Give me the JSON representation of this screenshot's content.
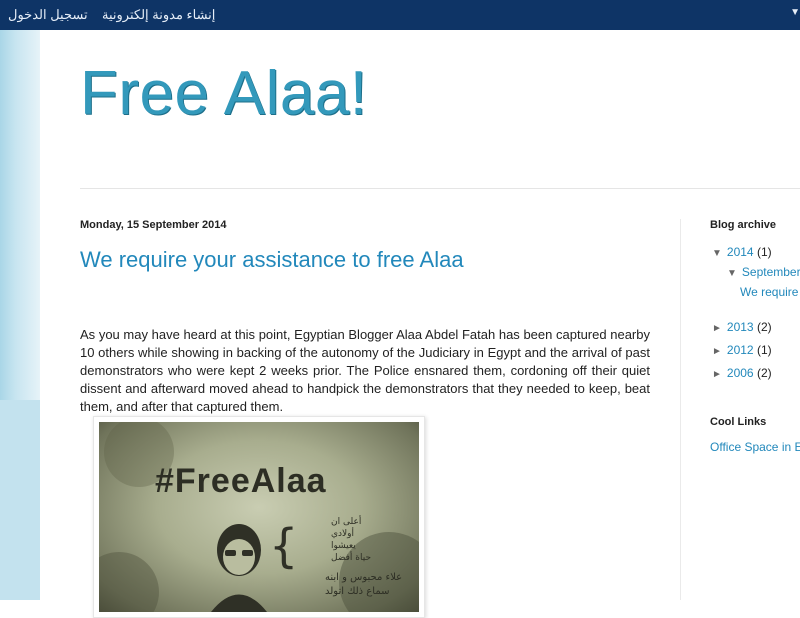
{
  "navbar": {
    "signin_label": "تسجيل الدخول",
    "create_blog_label": "إنشاء مدونة إلكترونية",
    "edge_glyph": "▼"
  },
  "header": {
    "title": "Free Alaa!"
  },
  "post": {
    "date": "Monday, 15 September 2014",
    "title": "We require your assistance to free Alaa",
    "body": "As you may have heard at this point, Egyptian Blogger Alaa Abdel Fatah has been captured nearby 10 others while showing in backing of the autonomy of the Judiciary in Egypt and the arrival of past demonstrators who were kept 2 weeks prior. The Police ensnared them, cordoning off their quiet dissent and afterward moved ahead to handpick the demonstrators that they needed to keep, beat them, and after that captured them.",
    "image": {
      "hashtag": "#FreeAlaa",
      "arabic_lines": [
        "أعلى ان",
        "أولادي",
        "يعيشوا",
        "حياة أفضل",
        "علاء محبوس و ابنه",
        "سماع ذلك اتولد"
      ]
    }
  },
  "sidebar": {
    "archive": {
      "title": "Blog archive",
      "years": [
        {
          "toggle": "▼",
          "year": "2014",
          "count": "(1)",
          "expanded": true,
          "months": [
            {
              "toggle": "▼",
              "name": "September",
              "posts": [
                "We require"
              ]
            }
          ]
        },
        {
          "toggle": "►",
          "year": "2013",
          "count": "(2)",
          "expanded": false
        },
        {
          "toggle": "►",
          "year": "2012",
          "count": "(1)",
          "expanded": false
        },
        {
          "toggle": "►",
          "year": "2006",
          "count": "(2)",
          "expanded": false
        }
      ]
    },
    "links": {
      "title": "Cool Links",
      "items": [
        "Office Space in E"
      ]
    }
  },
  "colors": {
    "navbar_bg": "#0e3466",
    "title": "#3399bb",
    "link": "#2288bb"
  }
}
